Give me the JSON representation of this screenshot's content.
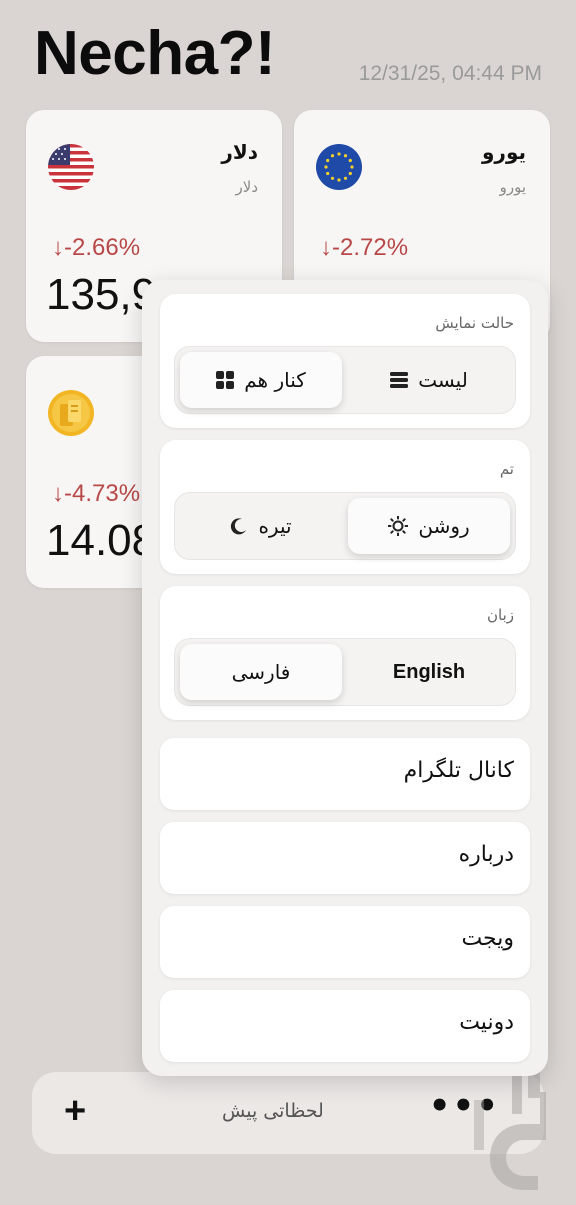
{
  "header": {
    "title": "Necha?!",
    "timestamp": "12/31/25, 04:44 PM"
  },
  "cards": [
    {
      "name": "دلار",
      "sub": "دلار",
      "change": "↓-2.66%",
      "price": "135,9",
      "flag_icon": "us-flag-icon",
      "change_color": "#b84848"
    },
    {
      "name": "یورو",
      "sub": "یورو",
      "change": "↓-2.72%",
      "price": "",
      "flag_icon": "eu-flag-icon",
      "change_color": "#b84848"
    },
    {
      "name": "",
      "sub": "",
      "change": "↓-4.73%",
      "price": "14.08",
      "flag_icon": "gold-coin-icon",
      "change_color": "#b84848"
    }
  ],
  "menu": {
    "display_mode": {
      "title": "حالت نمایش",
      "options": [
        {
          "label": "کنار هم",
          "icon": "grid-icon",
          "selected": true
        },
        {
          "label": "لیست",
          "icon": "list-icon",
          "selected": false
        }
      ]
    },
    "theme": {
      "title": "تم",
      "options": [
        {
          "label": "تیره",
          "icon": "moon-icon",
          "selected": false
        },
        {
          "label": "روشن",
          "icon": "sun-icon",
          "selected": true
        }
      ]
    },
    "language": {
      "title": "زبان",
      "options": [
        {
          "label": "فارسی",
          "selected": true
        },
        {
          "label": "English",
          "selected": false
        }
      ]
    },
    "links": [
      {
        "label": "کانال تلگرام"
      },
      {
        "label": "درباره"
      },
      {
        "label": "ویجت"
      },
      {
        "label": "دونیت"
      }
    ]
  },
  "bottom_bar": {
    "add_label": "+",
    "label": "لحظاتی پیش",
    "more_label": "•••"
  },
  "colors": {
    "background": "#dad5d2",
    "card": "#f7f6f5",
    "negative": "#b84848"
  }
}
